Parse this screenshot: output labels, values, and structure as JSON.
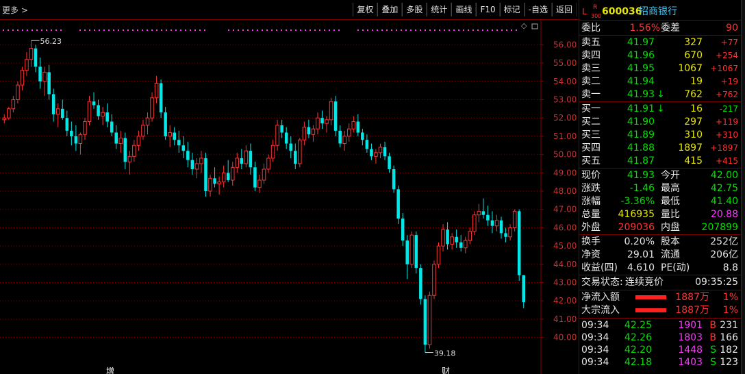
{
  "toolbar": {
    "more_label": "更多",
    "buttons": [
      "复权",
      "叠加",
      "多股",
      "统计",
      "画线",
      "F10",
      "标记",
      "-自选",
      "返回"
    ]
  },
  "chart_data": {
    "type": "candlestick",
    "y_ticks": [
      "56.00",
      "55.00",
      "54.00",
      "53.00",
      "52.00",
      "51.00",
      "50.00",
      "49.00",
      "48.00",
      "47.00",
      "46.00",
      "45.00",
      "44.00",
      "43.00",
      "42.00",
      "41.00",
      "40.00"
    ],
    "ylim": [
      39.5,
      56.5
    ],
    "annotations": {
      "max_label": "56.23",
      "min_label": "39.18",
      "bottom_marks": [
        "增",
        "财"
      ]
    },
    "colors": {
      "up": "#ff3333",
      "down": "#00e8e8",
      "grid": "#8b0000",
      "dots": "#ff33ff"
    },
    "candles": [
      [
        51.9,
        52.2,
        51.7,
        52.0
      ],
      [
        52.0,
        52.6,
        51.9,
        52.5
      ],
      [
        52.5,
        53.2,
        52.3,
        53.0
      ],
      [
        53.0,
        54.0,
        52.8,
        53.8
      ],
      [
        53.8,
        54.8,
        53.5,
        54.6
      ],
      [
        54.6,
        55.6,
        54.3,
        55.2
      ],
      [
        55.2,
        56.23,
        54.8,
        55.8
      ],
      [
        55.8,
        56.0,
        54.5,
        54.8
      ],
      [
        54.8,
        55.3,
        53.6,
        54.0
      ],
      [
        54.0,
        54.8,
        53.2,
        54.5
      ],
      [
        54.5,
        54.9,
        53.0,
        53.3
      ],
      [
        53.3,
        53.6,
        51.8,
        52.2
      ],
      [
        52.2,
        52.8,
        51.5,
        52.5
      ],
      [
        52.5,
        53.0,
        51.9,
        52.0
      ],
      [
        52.0,
        52.4,
        51.0,
        51.3
      ],
      [
        51.3,
        51.8,
        50.5,
        51.0
      ],
      [
        51.0,
        51.6,
        50.2,
        50.6
      ],
      [
        50.6,
        51.2,
        50.0,
        51.1
      ],
      [
        51.1,
        52.0,
        50.8,
        51.8
      ],
      [
        51.8,
        53.2,
        51.6,
        52.9
      ],
      [
        52.9,
        53.4,
        52.5,
        52.7
      ],
      [
        52.7,
        53.0,
        51.9,
        52.1
      ],
      [
        52.1,
        52.6,
        51.6,
        52.3
      ],
      [
        52.3,
        52.8,
        51.5,
        51.8
      ],
      [
        51.8,
        52.2,
        51.0,
        51.2
      ],
      [
        51.2,
        51.6,
        50.3,
        50.6
      ],
      [
        50.6,
        51.3,
        50.1,
        50.9
      ],
      [
        50.9,
        51.2,
        49.2,
        49.6
      ],
      [
        49.6,
        50.2,
        48.9,
        49.9
      ],
      [
        49.9,
        50.8,
        49.6,
        50.5
      ],
      [
        50.5,
        51.3,
        50.2,
        51.0
      ],
      [
        51.0,
        51.9,
        50.8,
        51.6
      ],
      [
        51.6,
        52.3,
        51.1,
        52.0
      ],
      [
        52.0,
        53.4,
        51.8,
        53.1
      ],
      [
        53.1,
        54.3,
        52.8,
        53.9
      ],
      [
        53.9,
        54.1,
        52.0,
        52.3
      ],
      [
        52.3,
        52.6,
        50.8,
        51.0
      ],
      [
        51.0,
        51.6,
        50.4,
        51.2
      ],
      [
        51.2,
        51.5,
        50.5,
        50.8
      ],
      [
        50.8,
        51.3,
        50.1,
        50.5
      ],
      [
        50.5,
        51.0,
        49.8,
        50.2
      ],
      [
        50.2,
        50.7,
        49.3,
        49.7
      ],
      [
        49.7,
        50.1,
        48.9,
        49.2
      ],
      [
        49.2,
        49.8,
        48.7,
        49.5
      ],
      [
        49.5,
        50.2,
        49.0,
        49.8
      ],
      [
        49.8,
        50.1,
        47.7,
        48.0
      ],
      [
        48.0,
        48.9,
        47.7,
        48.7
      ],
      [
        48.7,
        49.3,
        48.2,
        48.4
      ],
      [
        48.4,
        48.8,
        47.8,
        48.5
      ],
      [
        48.5,
        49.4,
        48.2,
        49.0
      ],
      [
        49.0,
        49.7,
        48.5,
        48.6
      ],
      [
        48.6,
        49.6,
        48.3,
        49.3
      ],
      [
        49.3,
        50.1,
        49.0,
        49.8
      ],
      [
        49.8,
        50.3,
        49.2,
        49.5
      ],
      [
        49.5,
        50.5,
        49.3,
        50.2
      ],
      [
        50.2,
        50.6,
        48.9,
        49.3
      ],
      [
        49.3,
        49.6,
        48.0,
        48.2
      ],
      [
        48.2,
        48.9,
        47.9,
        48.6
      ],
      [
        48.6,
        49.5,
        48.4,
        49.2
      ],
      [
        49.2,
        50.0,
        49.0,
        49.8
      ],
      [
        49.8,
        50.8,
        49.6,
        50.5
      ],
      [
        50.5,
        51.9,
        50.2,
        51.6
      ],
      [
        51.6,
        51.9,
        50.9,
        51.2
      ],
      [
        51.2,
        51.5,
        50.3,
        50.6
      ],
      [
        50.6,
        51.0,
        49.8,
        50.2
      ],
      [
        50.2,
        50.6,
        49.2,
        49.5
      ],
      [
        49.5,
        50.9,
        49.3,
        50.8
      ],
      [
        50.8,
        51.8,
        50.5,
        51.5
      ],
      [
        51.5,
        51.9,
        50.9,
        51.1
      ],
      [
        51.1,
        51.6,
        50.7,
        51.4
      ],
      [
        51.4,
        52.3,
        51.1,
        52.0
      ],
      [
        52.0,
        52.4,
        51.4,
        51.7
      ],
      [
        51.7,
        52.1,
        51.2,
        51.9
      ],
      [
        51.9,
        53.1,
        51.6,
        52.9
      ],
      [
        52.9,
        53.2,
        51.0,
        51.3
      ],
      [
        51.3,
        51.6,
        50.4,
        50.6
      ],
      [
        50.6,
        51.3,
        50.2,
        51.0
      ],
      [
        51.0,
        51.7,
        50.7,
        51.4
      ],
      [
        51.4,
        52.1,
        51.2,
        51.8
      ],
      [
        51.8,
        52.2,
        51.0,
        51.2
      ],
      [
        51.2,
        51.4,
        50.5,
        50.8
      ],
      [
        50.8,
        51.1,
        50.1,
        50.3
      ],
      [
        50.3,
        50.6,
        49.7,
        49.9
      ],
      [
        49.9,
        50.3,
        49.5,
        50.1
      ],
      [
        50.1,
        50.6,
        49.8,
        50.4
      ],
      [
        50.4,
        50.7,
        49.7,
        49.9
      ],
      [
        49.9,
        50.1,
        49.0,
        49.2
      ],
      [
        49.2,
        49.4,
        47.9,
        48.1
      ],
      [
        48.1,
        48.3,
        46.2,
        46.5
      ],
      [
        46.5,
        46.8,
        45.0,
        45.3
      ],
      [
        45.3,
        45.6,
        43.2,
        44.0
      ],
      [
        44.0,
        45.8,
        43.8,
        45.6
      ],
      [
        45.6,
        45.8,
        43.5,
        43.8
      ],
      [
        43.8,
        44.0,
        41.8,
        42.1
      ],
      [
        42.1,
        42.3,
        39.18,
        39.6
      ],
      [
        39.6,
        42.5,
        39.4,
        42.3
      ],
      [
        42.3,
        44.2,
        42.1,
        44.0
      ],
      [
        44.0,
        45.2,
        43.8,
        45.0
      ],
      [
        45.0,
        46.2,
        44.7,
        45.9
      ],
      [
        45.9,
        46.3,
        44.8,
        45.1
      ],
      [
        45.1,
        45.7,
        44.8,
        45.5
      ],
      [
        45.5,
        45.9,
        44.9,
        45.2
      ],
      [
        45.2,
        45.6,
        44.7,
        44.9
      ],
      [
        44.9,
        45.5,
        44.6,
        45.3
      ],
      [
        45.3,
        46.0,
        45.1,
        45.8
      ],
      [
        45.8,
        46.9,
        45.6,
        46.7
      ],
      [
        46.7,
        47.3,
        46.3,
        46.9
      ],
      [
        46.9,
        47.6,
        46.5,
        46.7
      ],
      [
        46.7,
        47.2,
        46.1,
        46.4
      ],
      [
        46.4,
        46.9,
        45.7,
        46.1
      ],
      [
        46.1,
        46.7,
        45.8,
        46.4
      ],
      [
        46.4,
        46.6,
        45.4,
        45.7
      ],
      [
        45.7,
        46.0,
        45.2,
        45.5
      ],
      [
        45.5,
        46.2,
        45.3,
        46.0
      ],
      [
        46.0,
        47.0,
        45.8,
        46.9
      ],
      [
        46.9,
        47.0,
        43.1,
        43.4
      ],
      [
        43.4,
        43.4,
        41.6,
        41.93
      ]
    ]
  },
  "quote": {
    "header": {
      "tag_l": "L",
      "tag_r": "R",
      "tag_300": "300",
      "code": "600036",
      "name": "招商银行"
    },
    "weibi": {
      "label": "委比",
      "value": "1.56%",
      "label2": "委差",
      "value2": "90"
    },
    "asks": [
      {
        "label": "卖五",
        "price": "41.97",
        "vol": "327",
        "chg": "+77"
      },
      {
        "label": "卖四",
        "price": "41.96",
        "vol": "670",
        "chg": "+254"
      },
      {
        "label": "卖三",
        "price": "41.95",
        "vol": "1067",
        "chg": "+1067"
      },
      {
        "label": "卖二",
        "price": "41.94",
        "vol": "19",
        "chg": "+19"
      },
      {
        "label": "卖一",
        "price": "41.93",
        "arrow": "↓",
        "vol": "762",
        "chg": "+762"
      }
    ],
    "bids": [
      {
        "label": "买一",
        "price": "41.91",
        "arrow": "↓",
        "vol": "16",
        "chg": "-217"
      },
      {
        "label": "买二",
        "price": "41.90",
        "vol": "297",
        "chg": "+119"
      },
      {
        "label": "买三",
        "price": "41.89",
        "vol": "310",
        "chg": "+310"
      },
      {
        "label": "买四",
        "price": "41.88",
        "vol": "1897",
        "chg": "+1897"
      },
      {
        "label": "买五",
        "price": "41.87",
        "vol": "415",
        "chg": "+415"
      }
    ],
    "stats": [
      {
        "l1": "现价",
        "v1": "41.93",
        "l2": "今开",
        "v2": "42.00",
        "c1": "g",
        "c2": "g"
      },
      {
        "l1": "涨跌",
        "v1": "-1.46",
        "l2": "最高",
        "v2": "42.75",
        "c1": "g",
        "c2": "g"
      },
      {
        "l1": "涨幅",
        "v1": "-3.36%",
        "l2": "最低",
        "v2": "41.40",
        "c1": "g",
        "c2": "g"
      },
      {
        "l1": "总量",
        "v1": "416935",
        "l2": "量比",
        "v2": "20.88",
        "c1": "y",
        "c2": "m"
      },
      {
        "l1": "外盘",
        "v1": "209036",
        "l2": "内盘",
        "v2": "207899",
        "c1": "r",
        "c2": "g"
      }
    ],
    "fundamentals": [
      {
        "l1": "换手",
        "v1": "0.20%",
        "l2": "股本",
        "v2": "252亿"
      },
      {
        "l1": "净资",
        "v1": "29.01",
        "l2": "流通",
        "v2": "206亿"
      },
      {
        "l1": "收益(四)",
        "v1": "4.610",
        "l2": "PE(动)",
        "v2": "8.8"
      }
    ],
    "trade_status": {
      "label": "交易状态:",
      "value": "连续竞价",
      "time": "09:35:25"
    },
    "flows": [
      {
        "label": "净流入额",
        "value": "1887万",
        "pct": "1%"
      },
      {
        "label": "大宗流入",
        "value": "1887万",
        "pct": "1%"
      }
    ],
    "ticks": [
      {
        "time": "09:34",
        "price": "42.25",
        "vol": "1901",
        "side": "B",
        "num": "231"
      },
      {
        "time": "09:34",
        "price": "42.26",
        "vol": "1803",
        "side": "B",
        "num": "166"
      },
      {
        "time": "09:34",
        "price": "42.20",
        "vol": "1448",
        "side": "S",
        "num": "182"
      },
      {
        "time": "09:34",
        "price": "42.18",
        "vol": "1403",
        "side": "S",
        "num": "123"
      }
    ]
  }
}
